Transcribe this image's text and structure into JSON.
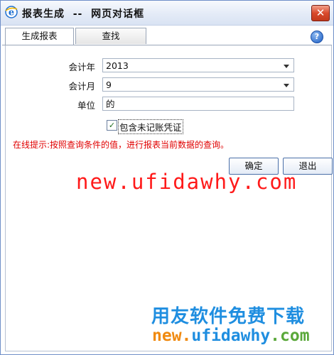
{
  "window": {
    "title": "报表生成  --  网页对话框",
    "close_label": "✕",
    "help_label": "?"
  },
  "tabs": [
    {
      "label": "生成报表",
      "active": true
    },
    {
      "label": "查找",
      "active": false
    }
  ],
  "form": {
    "year_label": "会计年",
    "year_value": "2013",
    "month_label": "会计月",
    "month_value": "9",
    "unit_label": "单位",
    "unit_value": "的",
    "checkbox_label": "包含未记账凭证",
    "checkbox_checked": true,
    "tip": "在线提示:按照查询条件的值，进行报表当前数据的查询。",
    "ok_label": "确定",
    "exit_label": "退出"
  },
  "watermark": {
    "url_top": "new.ufidawhy.com",
    "slogan": "用友软件免费下载",
    "url_part1": "new.",
    "url_part2": "ufidawhy",
    "url_part3": ".com"
  },
  "colors": {
    "tip_red": "#e00000",
    "watermark_red": "#ff1a1a",
    "slogan_blue": "#1f8ee0",
    "close_red": "#d94a2c"
  },
  "icons": {
    "app": "ie-e-icon",
    "close": "close-icon",
    "help": "help-icon",
    "dropdown": "chevron-down-icon",
    "check": "checkmark-icon"
  }
}
